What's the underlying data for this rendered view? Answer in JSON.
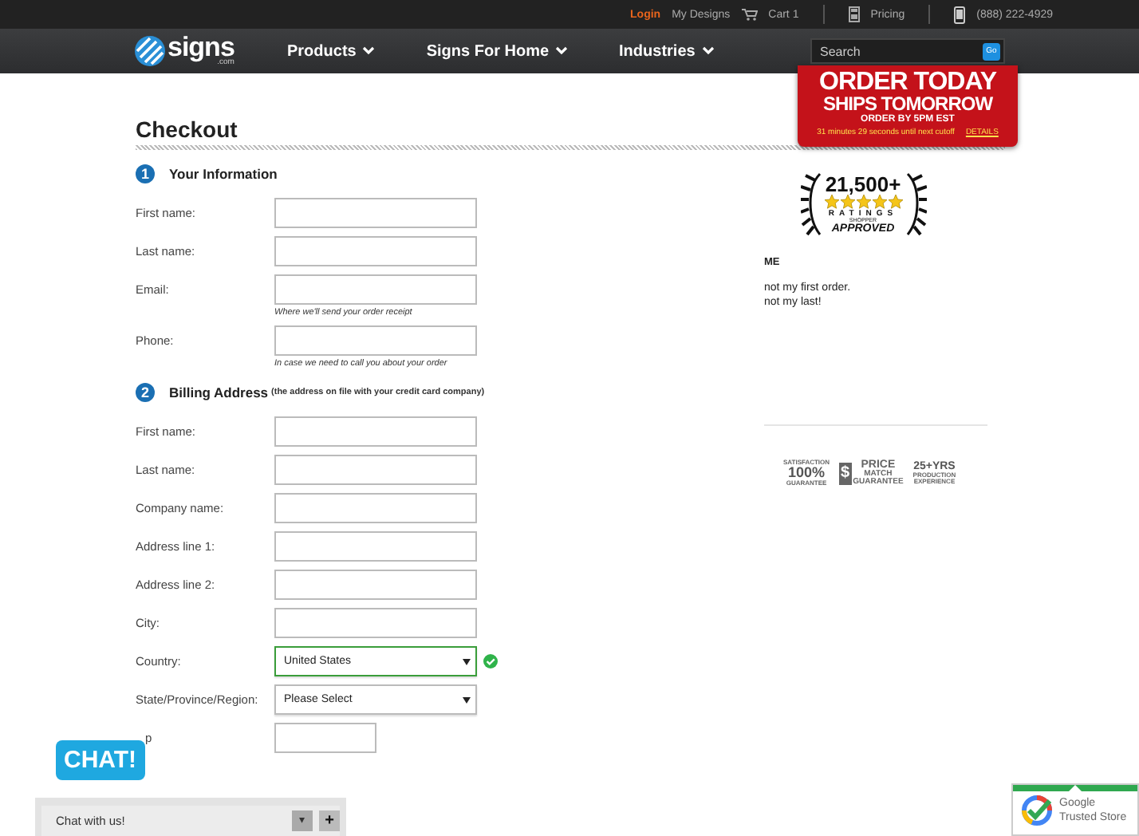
{
  "topbar": {
    "links": [
      {
        "kind": "login",
        "label": "Login"
      },
      {
        "kind": "plain",
        "label": "My Designs"
      },
      {
        "kind": "cart",
        "label": "Cart 1"
      },
      {
        "kind": "pricing",
        "label": "Pricing"
      },
      {
        "kind": "phone",
        "label": "(888) 222-4929"
      }
    ]
  },
  "nav": {
    "logo": {
      "name": "signs",
      "suffix": ".com"
    },
    "items": [
      "Products",
      "Signs For Home",
      "Industries"
    ],
    "search": {
      "placeholder": "Search",
      "button": "Go"
    }
  },
  "promo": {
    "headline": "ORDER TODAY",
    "subhead": "SHIPS TOMORROW",
    "deadline": "ORDER BY 5PM EST",
    "countdown": "31 minutes 29 seconds until next cutoff",
    "link": "DETAILS"
  },
  "page_title": "Checkout",
  "sections": [
    {
      "number": "1",
      "title": "Your Information",
      "fields": [
        {
          "label": "First name:",
          "kind": "text"
        },
        {
          "label": "Last name:",
          "kind": "text"
        },
        {
          "label": "Email:",
          "kind": "text",
          "hint": "Where we'll send your order receipt"
        },
        {
          "label": "Phone:",
          "kind": "text",
          "hint": "In case we need to call you about your order"
        }
      ]
    },
    {
      "number": "2",
      "title": "Billing Address",
      "note": "(the address on file with your credit card company)",
      "fields": [
        {
          "label": "First name:",
          "kind": "text"
        },
        {
          "label": "Last name:",
          "kind": "text"
        },
        {
          "label": "Company name:",
          "kind": "text"
        },
        {
          "label": "Address line 1:",
          "kind": "text"
        },
        {
          "label": "Address line 2:",
          "kind": "text"
        },
        {
          "label": "City:",
          "kind": "text"
        },
        {
          "label": "Country:",
          "kind": "select",
          "value": "United States",
          "valid": true
        },
        {
          "label": "State/Province/Region:",
          "kind": "select",
          "value": "Please Select",
          "valid": false
        },
        {
          "label": "p",
          "kind": "short",
          "covered": true
        }
      ]
    }
  ],
  "rating": {
    "count": "21,500+",
    "stars": 5,
    "label": "RATINGS",
    "brand_top": "SHOPPER",
    "brand": "APPROVED"
  },
  "review": {
    "author": "ME",
    "lines": [
      "not my first order.",
      "not my last!"
    ]
  },
  "guarantees": [
    {
      "lines": [
        "SATISFACTION",
        "100%",
        "GUARANTEE"
      ]
    },
    {
      "symbol": "$",
      "lines": [
        "PRICE",
        "MATCH",
        "GUARANTEE"
      ]
    },
    {
      "lines": [
        "25+YRS",
        "PRODUCTION",
        "EXPERIENCE"
      ]
    }
  ],
  "chat": {
    "bubble": "CHAT!",
    "bar": "Chat with us!",
    "buttons": [
      "▾",
      "+"
    ]
  },
  "trusted": {
    "lines": [
      "Google",
      "Trusted Store"
    ]
  }
}
